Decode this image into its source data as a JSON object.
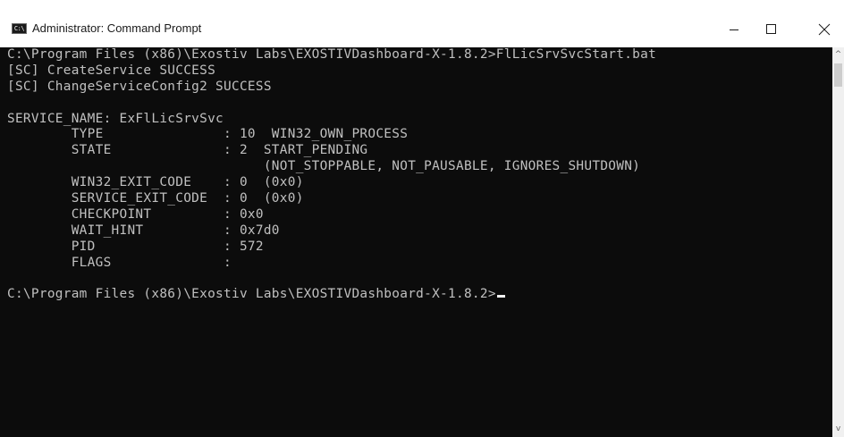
{
  "window": {
    "title": "Administrator: Command Prompt",
    "icon_label": "C:\\",
    "icon": "cmd-icon",
    "buttons": {
      "minimize_icon": "minimize-icon",
      "maximize_icon": "maximize-icon",
      "close_icon": "close-icon"
    }
  },
  "console": {
    "background": "#0c0c0c",
    "foreground": "#c0c0c0",
    "lines": [
      "C:\\Program Files (x86)\\Exostiv Labs\\EXOSTIVDashboard-X-1.8.2>FlLicSrvSvcStart.bat",
      "[SC] CreateService SUCCESS",
      "[SC] ChangeServiceConfig2 SUCCESS",
      "",
      "SERVICE_NAME: ExFlLicSrvSvc",
      "        TYPE               : 10  WIN32_OWN_PROCESS",
      "        STATE              : 2  START_PENDING",
      "                                (NOT_STOPPABLE, NOT_PAUSABLE, IGNORES_SHUTDOWN)",
      "        WIN32_EXIT_CODE    : 0  (0x0)",
      "        SERVICE_EXIT_CODE  : 0  (0x0)",
      "        CHECKPOINT         : 0x0",
      "        WAIT_HINT          : 0x7d0",
      "        PID                : 572",
      "        FLAGS              :",
      "",
      "C:\\Program Files (x86)\\Exostiv Labs\\EXOSTIVDashboard-X-1.8.2>"
    ]
  },
  "scrollbar": {
    "up_glyph": "^",
    "down_glyph": "v"
  }
}
